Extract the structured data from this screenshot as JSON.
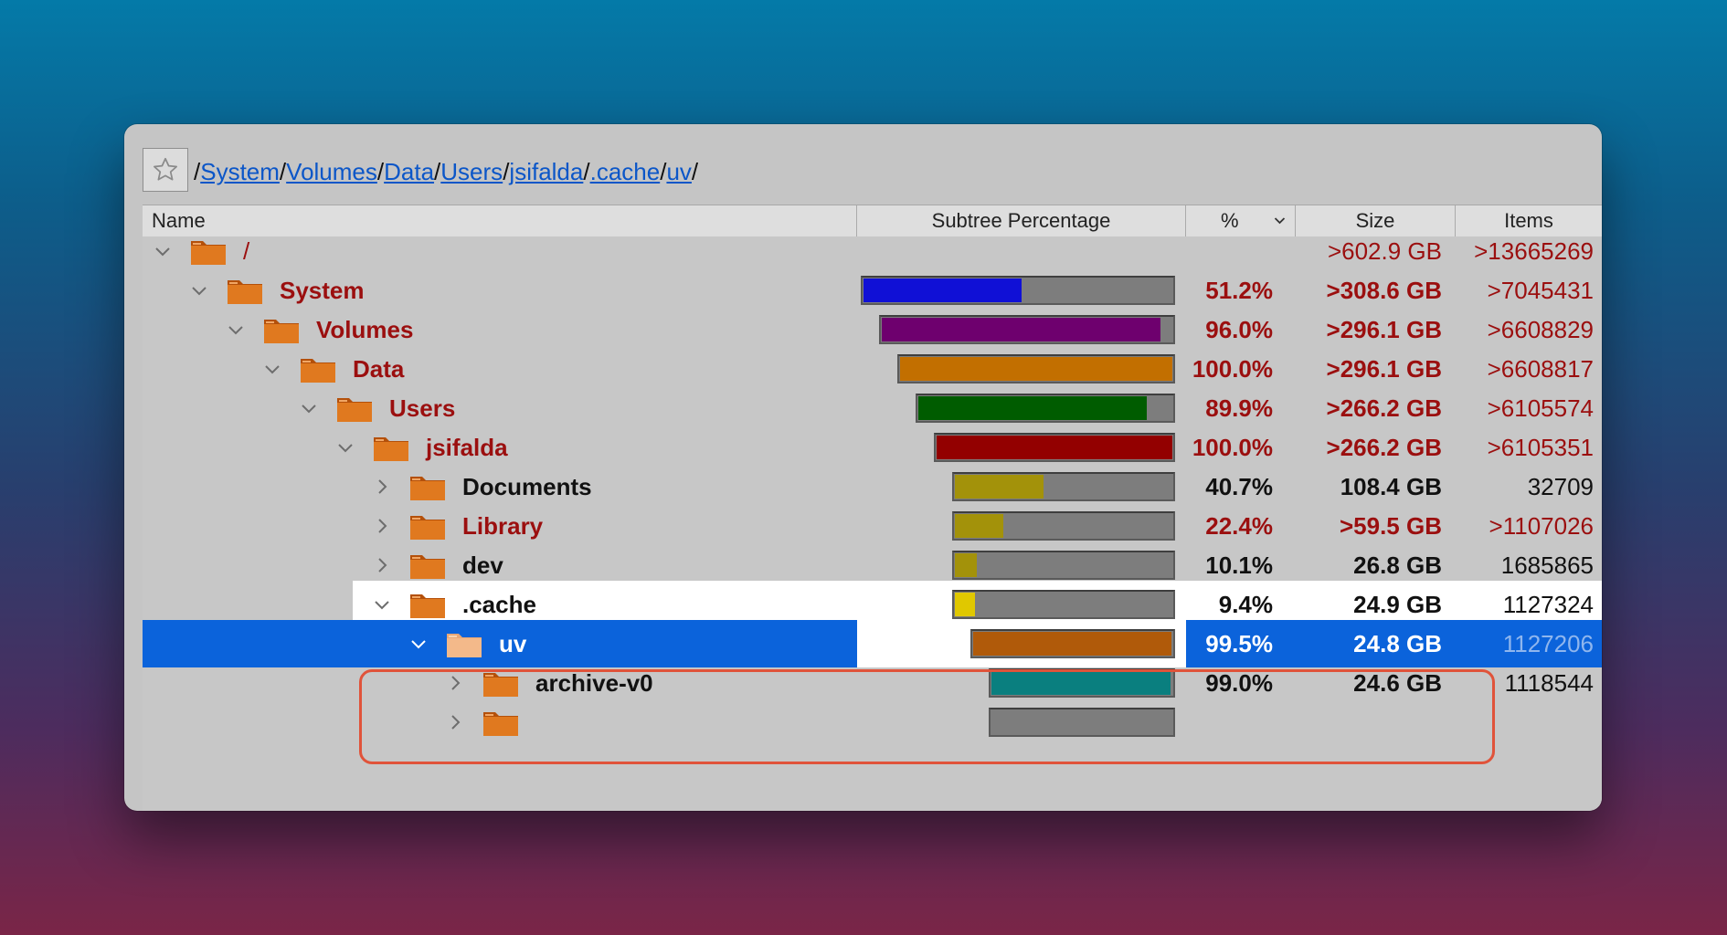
{
  "toolbar": {
    "favorite_icon": "star-outline-icon"
  },
  "path": {
    "segments": [
      "System",
      "Volumes",
      "Data",
      "Users",
      "jsifalda",
      ".cache",
      "uv"
    ],
    "separator": "/"
  },
  "columns": {
    "name": "Name",
    "subtree": "Subtree Percentage",
    "percent": "%",
    "size": "Size",
    "items": "Items"
  },
  "rows": [
    {
      "name": "/",
      "expanded": true,
      "percent": "",
      "fraction": null,
      "size": ">602.9 GB",
      "items": ">13665269",
      "bar_color": ""
    },
    {
      "name": "System",
      "expanded": true,
      "percent": "51.2%",
      "fraction": 0.512,
      "size": ">308.6 GB",
      "items": ">7045431",
      "bar_color": "#1010d6"
    },
    {
      "name": "Volumes",
      "expanded": true,
      "percent": "96.0%",
      "fraction": 0.96,
      "size": ">296.1 GB",
      "items": ">6608829",
      "bar_color": "#6e006e"
    },
    {
      "name": "Data",
      "expanded": true,
      "percent": "100.0%",
      "fraction": 1.0,
      "size": ">296.1 GB",
      "items": ">6608817",
      "bar_color": "#c26f00"
    },
    {
      "name": "Users",
      "expanded": true,
      "percent": "89.9%",
      "fraction": 0.899,
      "size": ">266.2 GB",
      "items": ">6105574",
      "bar_color": "#005c00"
    },
    {
      "name": "jsifalda",
      "expanded": true,
      "percent": "100.0%",
      "fraction": 1.0,
      "size": ">266.2 GB",
      "items": ">6105351",
      "bar_color": "#930000"
    },
    {
      "name": "Documents",
      "expanded": false,
      "percent": "40.7%",
      "fraction": 0.407,
      "size": "108.4 GB",
      "items": "32709",
      "bar_color": "#a3920a"
    },
    {
      "name": "Library",
      "expanded": false,
      "percent": "22.4%",
      "fraction": 0.224,
      "size": ">59.5 GB",
      "items": ">1107026",
      "bar_color": "#a3920a"
    },
    {
      "name": "dev",
      "expanded": false,
      "percent": "10.1%",
      "fraction": 0.101,
      "size": "26.8 GB",
      "items": "1685865",
      "bar_color": "#a3920a"
    },
    {
      "name": ".cache",
      "expanded": true,
      "percent": "9.4%",
      "fraction": 0.094,
      "size": "24.9 GB",
      "items": "1127324",
      "bar_color": "#e0c800"
    },
    {
      "name": "uv",
      "expanded": true,
      "selected": true,
      "percent": "99.5%",
      "fraction": 0.995,
      "size": "24.8 GB",
      "items": "1127206",
      "bar_color": "#b05a0a"
    },
    {
      "name": "archive-v0",
      "expanded": false,
      "percent": "99.0%",
      "fraction": 0.99,
      "size": "24.6 GB",
      "items": "1118544",
      "bar_color": "#0a7f7f"
    },
    {
      "name": "",
      "expanded": false,
      "percent": "",
      "fraction": null,
      "size": "",
      "items": "",
      "bar_color": "#7d7d7d"
    }
  ]
}
